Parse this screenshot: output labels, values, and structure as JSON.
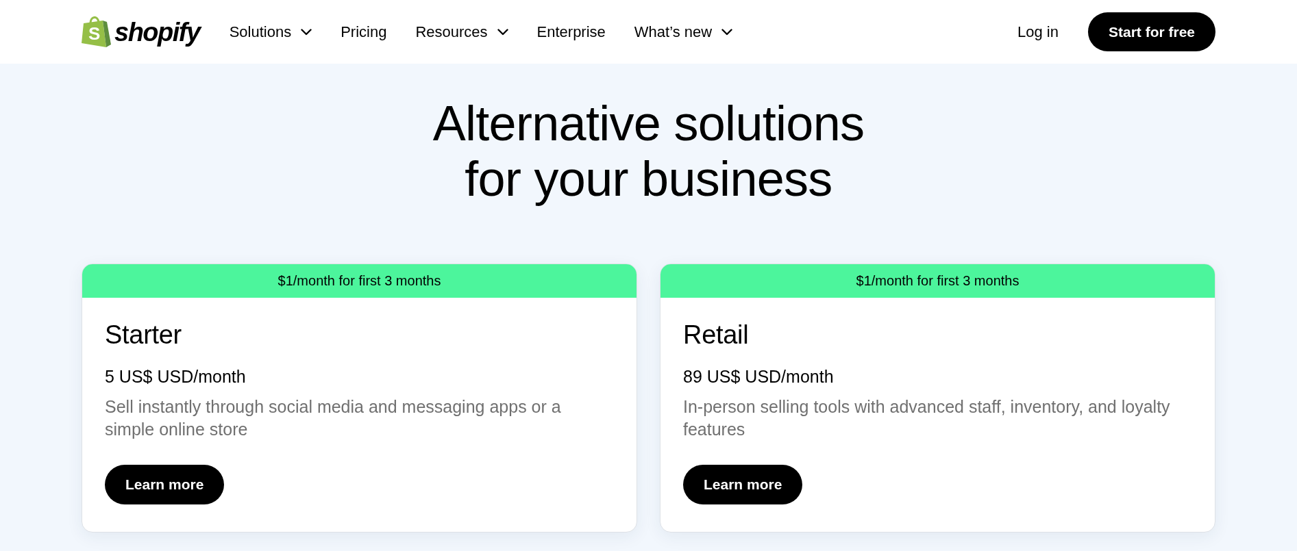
{
  "header": {
    "logo": {
      "mark": "S",
      "wordmark": "shopify"
    },
    "nav": [
      {
        "label": "Solutions",
        "dropdown": true
      },
      {
        "label": "Pricing",
        "dropdown": false
      },
      {
        "label": "Resources",
        "dropdown": true
      },
      {
        "label": "Enterprise",
        "dropdown": false
      },
      {
        "label": "What’s new",
        "dropdown": true
      }
    ],
    "login": "Log in",
    "cta": "Start for free"
  },
  "hero": {
    "title": "Alternative solutions for your business"
  },
  "plans": [
    {
      "banner": "$1/month for first 3 months",
      "name": "Starter",
      "price": "5 US$ USD/month",
      "description": "Sell instantly through social media and messaging apps or a simple online store",
      "button": "Learn more"
    },
    {
      "banner": "$1/month for first 3 months",
      "name": "Retail",
      "price": "89 US$ USD/month",
      "description": "In-person selling tools with advanced staff, inventory, and loyalty features",
      "button": "Learn more"
    }
  ]
}
